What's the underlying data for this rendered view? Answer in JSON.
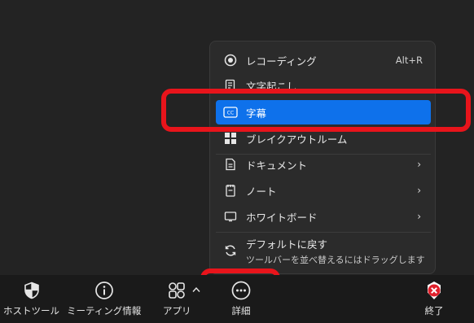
{
  "menu": {
    "recording": {
      "label": "レコーディング",
      "shortcut": "Alt+R"
    },
    "transcript": {
      "label": "文字起こし"
    },
    "captions": {
      "label": "字幕"
    },
    "breakout": {
      "label": "ブレイクアウトルーム"
    },
    "docs": {
      "label": "ドキュメント",
      "arrow": "›"
    },
    "notes": {
      "label": "ノート",
      "arrow": "›"
    },
    "whiteboard": {
      "label": "ホワイトボード",
      "arrow": "›"
    },
    "reset": {
      "label": "デフォルトに戻す",
      "sub": "ツールバーを並べ替えるにはドラッグします"
    }
  },
  "toolbar": {
    "host_tools": "ホストツール",
    "meeting_info": "ミーティング情報",
    "apps": "アプリ",
    "more": "詳細",
    "end": "終了"
  },
  "colors": {
    "accent": "#0e71eb",
    "annotation": "#e8141b",
    "end": "#e0212c"
  }
}
